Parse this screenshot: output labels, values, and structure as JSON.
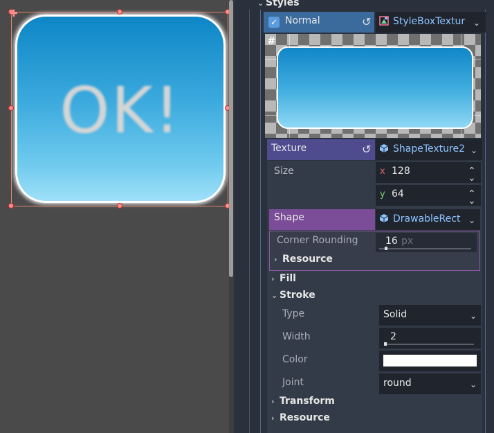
{
  "viewport": {
    "preview_text": "OK!"
  },
  "inspector": {
    "styles_label": "Styles",
    "normal": {
      "label": "Normal",
      "checked": true,
      "resource_type": "StyleBoxTextur"
    },
    "texture": {
      "label": "Texture",
      "resource_type": "ShapeTexture2"
    },
    "size": {
      "label": "Size",
      "x_axis": "x",
      "x_value": "128",
      "y_axis": "y",
      "y_value": "64"
    },
    "shape": {
      "label": "Shape",
      "resource_type": "DrawableRect",
      "corner_rounding_label": "Corner Rounding",
      "corner_rounding_value": "16",
      "corner_rounding_unit": "px",
      "resource_label": "Resource"
    },
    "fill_label": "Fill",
    "stroke": {
      "label": "Stroke",
      "type_label": "Type",
      "type_value": "Solid",
      "width_label": "Width",
      "width_value": "2",
      "color_label": "Color",
      "color_value": "#ffffff",
      "joint_label": "Joint",
      "joint_value": "round"
    },
    "transform_label": "Transform",
    "resource_label": "Resource"
  },
  "colors": {
    "texture_header": "#4f4b8f",
    "shape_header": "#7b4c98",
    "normal_header": "#3a6b9c",
    "resource_link": "#8fc4ff"
  }
}
